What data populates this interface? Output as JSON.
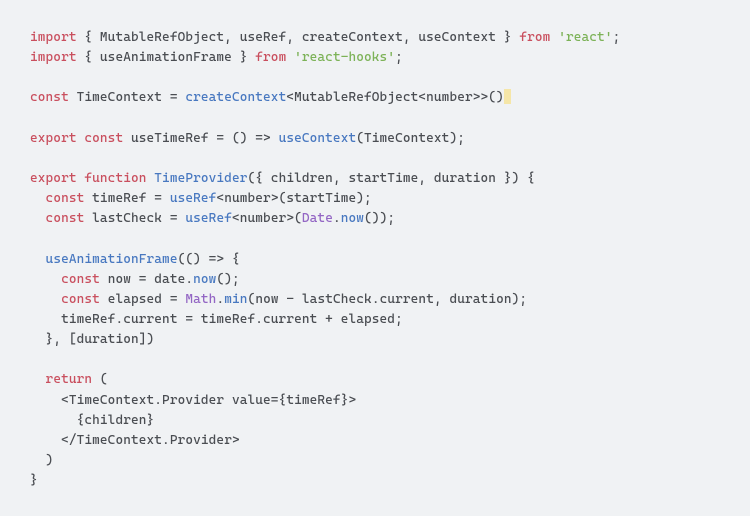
{
  "code": {
    "l1": {
      "kw1": "import",
      "imports": " { MutableRefObject, useRef, createContext, useContext } ",
      "kw2": "from",
      "str": " 'react'",
      "end": ";"
    },
    "l2": {
      "kw1": "import",
      "imports": " { useAnimationFrame } ",
      "kw2": "from",
      "str": " 'react-hooks'",
      "end": ";"
    },
    "l3": {
      "kw": "const",
      "name": " TimeContext = ",
      "fn": "createContext",
      "generic": "<MutableRefObject<number>>()"
    },
    "l4": {
      "kw1": "export",
      "kw2": " const",
      "name": " useTimeRef = () => ",
      "fn": "useContext",
      "rest": "(TimeContext);"
    },
    "l5": {
      "kw1": "export",
      "kw2": " function",
      "fn": " TimeProvider",
      "params": "({ children, startTime, duration }) {"
    },
    "l6": {
      "indent": "  ",
      "kw": "const",
      "name": " timeRef = ",
      "fn": "useRef",
      "rest": "<number>(startTime);"
    },
    "l7": {
      "indent": "  ",
      "kw": "const",
      "name": " lastCheck = ",
      "fn": "useRef",
      "rest1": "<number>(",
      "g": "Date",
      "rest2": ".",
      "fn2": "now",
      "rest3": "());"
    },
    "l8": {
      "indent": "  ",
      "fn": "useAnimationFrame",
      "rest": "(() => {"
    },
    "l9": {
      "indent": "    ",
      "kw": "const",
      "name": " now = date.",
      "fn": "now",
      "rest": "();"
    },
    "l10": {
      "indent": "    ",
      "kw": "const",
      "name": " elapsed = ",
      "g": "Math",
      "dot": ".",
      "fn": "min",
      "rest": "(now - lastCheck.current, duration);"
    },
    "l11": {
      "indent": "    ",
      "text": "timeRef.current = timeRef.current + elapsed;"
    },
    "l12": {
      "indent": "  ",
      "text": "}, [duration])"
    },
    "l13": {
      "indent": "  ",
      "kw": "return",
      "rest": " ("
    },
    "l14": {
      "indent": "    ",
      "text": "<TimeContext.Provider value={timeRef}>"
    },
    "l15": {
      "indent": "      ",
      "text": "{children}"
    },
    "l16": {
      "indent": "    ",
      "text": "</TimeContext.Provider>"
    },
    "l17": {
      "indent": "  ",
      "text": ")"
    },
    "l18": {
      "text": "}"
    }
  }
}
